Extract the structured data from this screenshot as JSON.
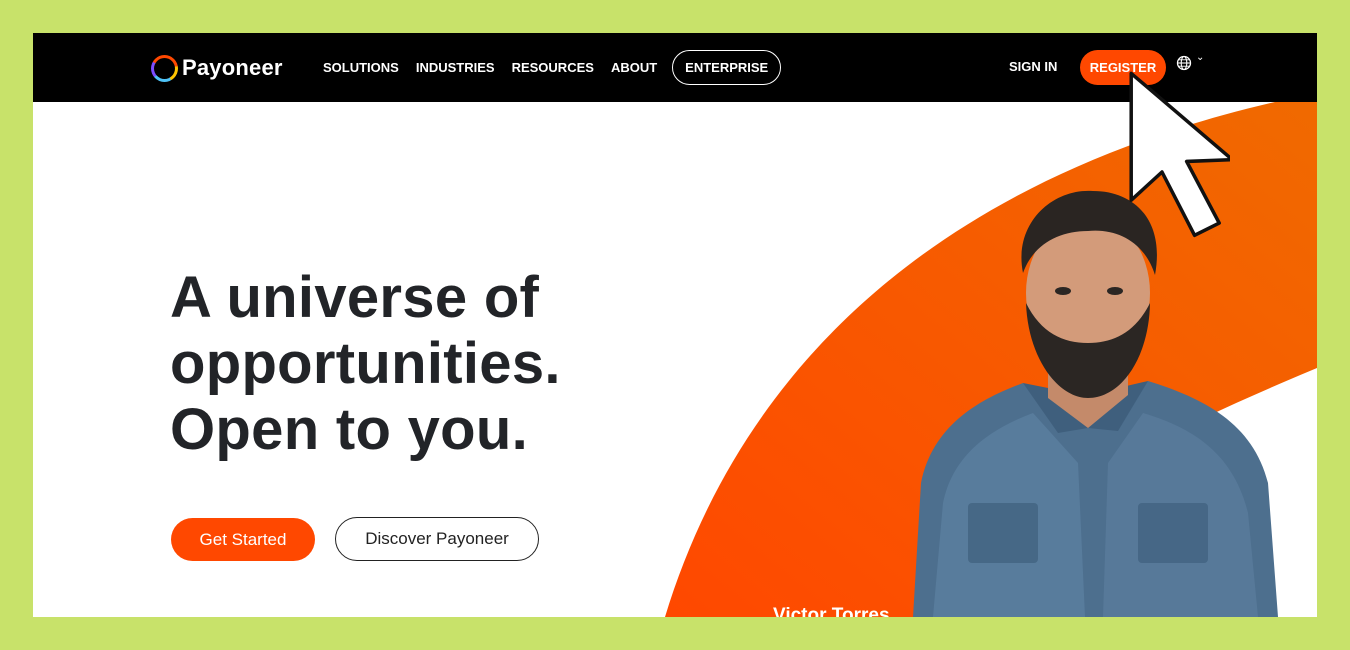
{
  "brand": {
    "name": "Payoneer",
    "accent": "#ff4800",
    "page_bg": "#c8e26a"
  },
  "nav": {
    "links": [
      "SOLUTIONS",
      "INDUSTRIES",
      "RESOURCES",
      "ABOUT"
    ],
    "enterprise": "ENTERPRISE",
    "sign_in": "SIGN IN",
    "register": "REGISTER",
    "language_icon": "globe-icon"
  },
  "hero": {
    "headline_lines": [
      "A universe of",
      "opportunities.",
      "Open to you."
    ],
    "primary_cta": "Get Started",
    "secondary_cta": "Discover Payoneer",
    "caption": "Victor Torres"
  },
  "overlay": {
    "cursor_icon": "mouse-pointer-icon"
  }
}
